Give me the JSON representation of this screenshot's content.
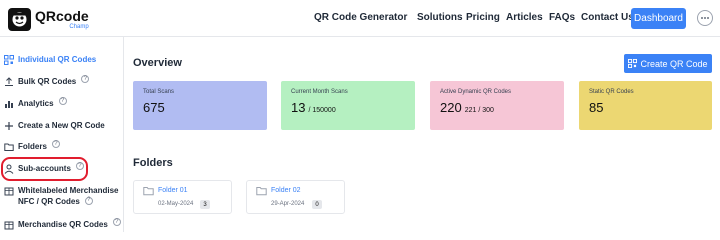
{
  "brand": {
    "name": "QRcode",
    "sub": "Champ"
  },
  "nav": {
    "items": [
      "QR Code Generator",
      "Solutions",
      "Pricing",
      "Articles",
      "FAQs",
      "Contact Us"
    ],
    "dashboard_label": "Dashboard"
  },
  "sidebar": {
    "items": [
      {
        "label": "Individual QR Codes",
        "icon": "qr-icon"
      },
      {
        "label": "Bulk QR Codes",
        "icon": "upload-icon"
      },
      {
        "label": "Analytics",
        "icon": "bar-chart-icon"
      },
      {
        "label": "Create a New QR Code",
        "icon": "plus-icon"
      },
      {
        "label": "Folders",
        "icon": "folder-icon"
      },
      {
        "label": "Sub-accounts",
        "icon": "user-icon"
      },
      {
        "label": "Whitelabeled Merchandise",
        "label2": "NFC / QR Codes",
        "icon": "box-icon"
      },
      {
        "label": "Merchandise QR Codes",
        "icon": "box-icon"
      }
    ],
    "help_mark": "?"
  },
  "main": {
    "overview_title": "Overview",
    "create_label": "Create QR Code",
    "folders_title": "Folders"
  },
  "stats": [
    {
      "label": "Total Scans",
      "value": "675",
      "sub": "",
      "color": "#b1bcf2"
    },
    {
      "label": "Current Month Scans",
      "value": "13",
      "sub": "/ 150000",
      "color": "#b5f0c1"
    },
    {
      "label": "Active Dynamic QR Codes",
      "value": "220",
      "sub": "221 / 300",
      "color": "#f6c6d6"
    },
    {
      "label": "Static QR Codes",
      "value": "85",
      "sub": "",
      "color": "#ecd772"
    }
  ],
  "folders": [
    {
      "name": "Folder 01",
      "date": "02-May-2024",
      "count": "3"
    },
    {
      "name": "Folder 02",
      "date": "29-Apr-2024",
      "count": "0"
    }
  ],
  "colors": {
    "accent": "#3b82f6",
    "highlight": "#e11d2e"
  }
}
